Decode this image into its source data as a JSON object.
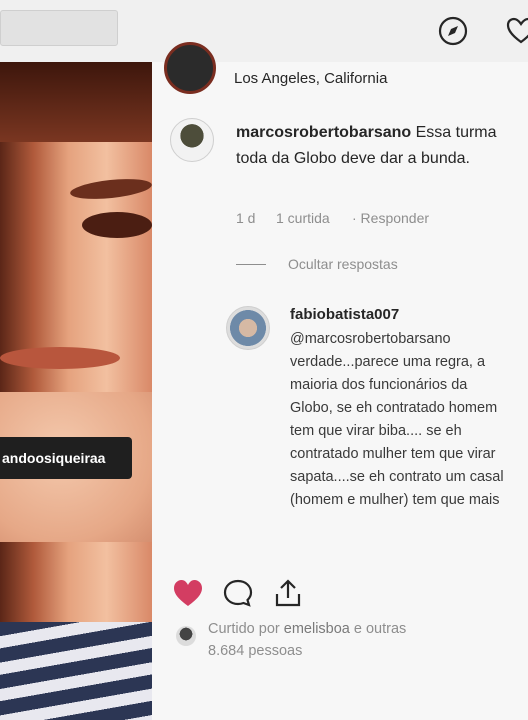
{
  "photo": {
    "tag_label": "andoosiqueiraa"
  },
  "post": {
    "location": "Los Angeles, California"
  },
  "comment_1": {
    "username": "marcosrobertobarsano",
    "text": " Essa turma toda da Globo deve dar a bunda.",
    "age": "1 d",
    "likes": "1 curtida",
    "reply_label": "· Responder",
    "hide_replies_label": "Ocultar respostas"
  },
  "reply_1": {
    "username": "fabiobatista007",
    "text": "@marcosrobertobarsano verdade...parece uma regra, a maioria dos funcionários da Globo, se eh contratado homem tem que virar biba.... se eh contratado mulher tem que virar sapata....se eh contrato um casal (homem e mulher) tem que mais"
  },
  "likes_summary": {
    "prefix": "Curtido por ",
    "user": "emelisboa",
    "suffix": " e outras 8.684 pessoas"
  },
  "colors": {
    "heart": "#d33d62",
    "muted_text": "#8e8e8e",
    "text": "#262626"
  },
  "icons": {
    "explore": "compass-icon",
    "activity": "heart-outline-icon",
    "like": "heart-filled-icon",
    "comment": "comment-bubble-icon",
    "share": "share-icon"
  }
}
